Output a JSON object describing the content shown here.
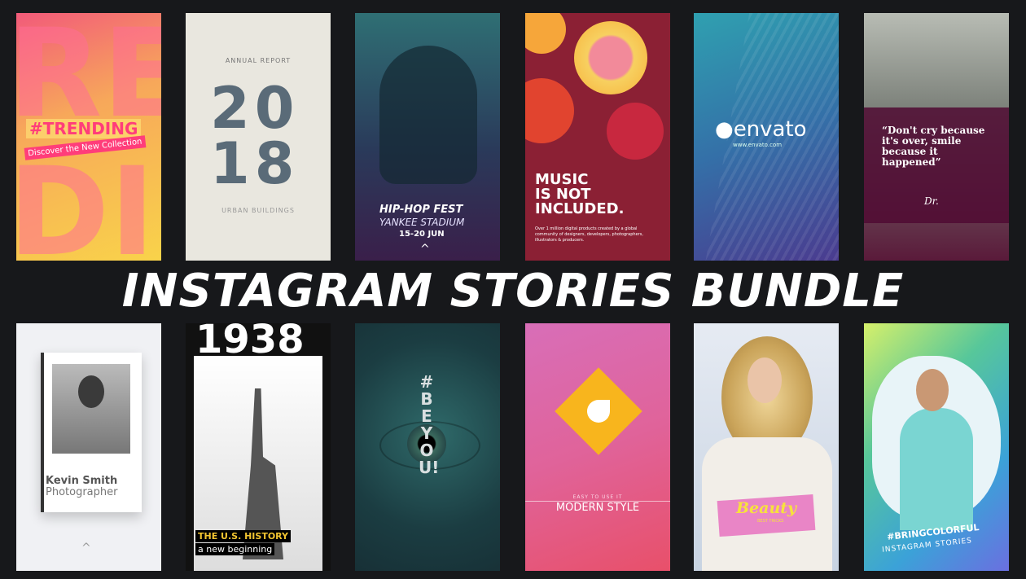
{
  "headline": "INSTAGRAM STORIES BUNDLE",
  "cards": {
    "trending": {
      "bg_letters_top": "RE",
      "bg_letters_bottom": "DI",
      "tag": "#TRENDING",
      "sub": "Discover the New Collection"
    },
    "annual": {
      "label": "ANNUAL REPORT",
      "year_top": "20",
      "year_bottom": "18",
      "caption": "URBAN BUILDINGS"
    },
    "hiphop": {
      "title": "HIP-HOP FEST",
      "venue": "YANKEE STADIUM",
      "dates": "15-20 JUN",
      "arrow": "^"
    },
    "music": {
      "title_line1": "MUSIC",
      "title_line2": "IS NOT",
      "title_line3": "INCLUDED.",
      "body": "Over 1 million digital products created by a global community of designers, developers, photographers, illustrators & producers."
    },
    "envato": {
      "logo": "envato",
      "url": "www.envato.com"
    },
    "quote": {
      "text": "“Don't cry because it's over, smile because it happened”",
      "signature": "Dr."
    },
    "kevin": {
      "name": "Kevin Smith",
      "role": "Photographer",
      "arrow": "^"
    },
    "liberty": {
      "year": "1938",
      "line1": "THE U.S. HISTORY",
      "line2": "a new beginning"
    },
    "beyou": {
      "text": "#BEYOU!"
    },
    "modern": {
      "pre": "EASY TO USE IT",
      "title": "MODERN STYLE"
    },
    "beauty": {
      "title": "Beauty",
      "sub": "BEST TRICKS"
    },
    "colorful": {
      "tag": "#BRINGCOLORFUL",
      "sub": "INSTAGRAM STORIES"
    }
  }
}
